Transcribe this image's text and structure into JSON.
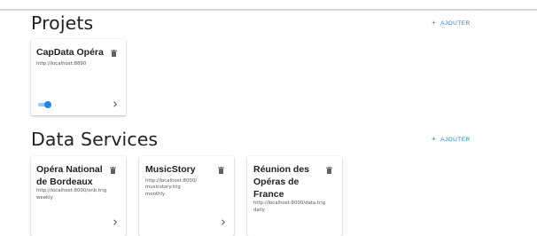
{
  "projects": {
    "title": "Projets",
    "add_label": "AJOUTER",
    "cards": [
      {
        "name": "CapData Opéra",
        "url": "http://localhost:8890",
        "enabled": true
      }
    ]
  },
  "data_services": {
    "title": "Data Services",
    "add_label": "AJOUTER",
    "cards": [
      {
        "name_line1": "Opéra National",
        "name_line2": "de Bordeaux",
        "url": "http://localhost:8000/onb.trig",
        "frequency": "weekly"
      },
      {
        "name": "MusicStory",
        "url_line1": "http://localhost:8000/",
        "url_line2": "musicstory.trig",
        "frequency": "monthly"
      },
      {
        "name_line1": "Réunion des",
        "name_line2": "Opéras de",
        "name_line3": "France",
        "url": "http://localhost:8000/data.trig",
        "frequency": "daily"
      }
    ]
  },
  "icons": {
    "add": "plus-icon",
    "delete": "trash-icon",
    "open": "chevron-right-icon",
    "toggle": "toggle-switch"
  },
  "colors": {
    "accent": "#1e88e5",
    "toggle_track": "#90caf9",
    "icon": "#616161"
  }
}
